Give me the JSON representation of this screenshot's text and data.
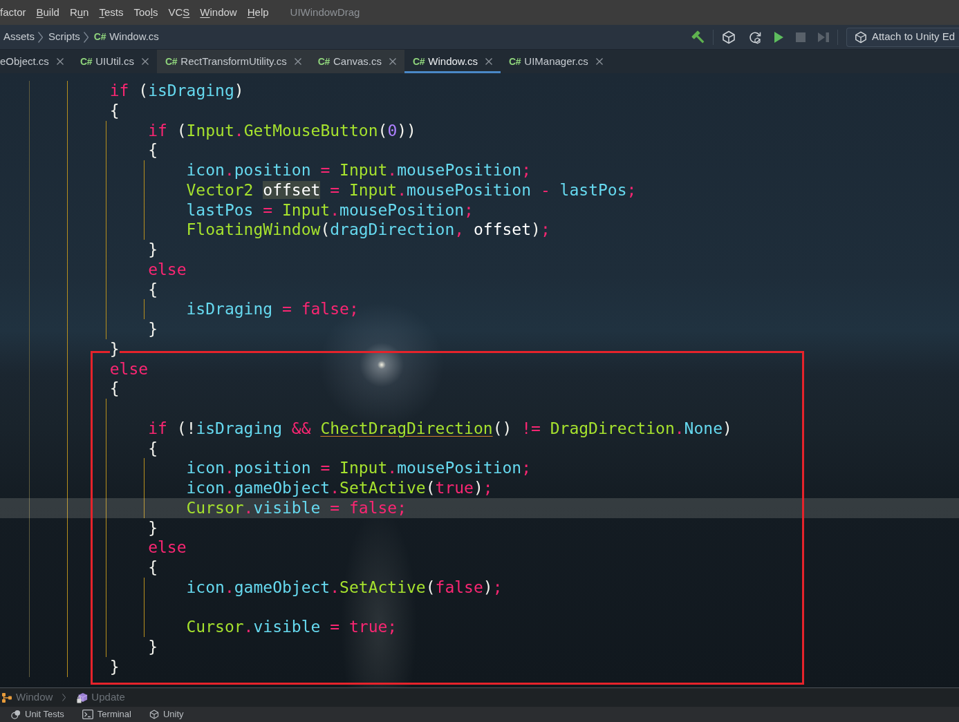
{
  "menu_bar": {
    "items": [
      {
        "label_parts": [
          {
            "kind": "plain",
            "text": "factor"
          }
        ]
      },
      {
        "label_parts": [
          {
            "kind": "mnemonic",
            "text": "B"
          },
          {
            "kind": "plain",
            "text": "uild"
          }
        ]
      },
      {
        "label_parts": [
          {
            "kind": "plain",
            "text": "R"
          },
          {
            "kind": "mnemonic",
            "text": "u"
          },
          {
            "kind": "plain",
            "text": "n"
          }
        ]
      },
      {
        "label_parts": [
          {
            "kind": "mnemonic",
            "text": "T"
          },
          {
            "kind": "plain",
            "text": "ests"
          }
        ]
      },
      {
        "label_parts": [
          {
            "kind": "plain",
            "text": "Too"
          },
          {
            "kind": "mnemonic",
            "text": "l"
          },
          {
            "kind": "plain",
            "text": "s"
          }
        ]
      },
      {
        "label_parts": [
          {
            "kind": "plain",
            "text": "VC"
          },
          {
            "kind": "mnemonic",
            "text": "S"
          }
        ]
      },
      {
        "label_parts": [
          {
            "kind": "mnemonic",
            "text": "W"
          },
          {
            "kind": "plain",
            "text": "indow"
          }
        ]
      },
      {
        "label_parts": [
          {
            "kind": "mnemonic",
            "text": "H"
          },
          {
            "kind": "plain",
            "text": "elp"
          }
        ]
      }
    ],
    "project_title": "UIWindowDrag"
  },
  "navigation_bar": {
    "breadcrumbs": [
      {
        "label": "Assets"
      },
      {
        "label": "Scripts"
      },
      {
        "file_icon": "C#",
        "label": "Window.cs"
      }
    ],
    "toolbar_groups": [
      {
        "buttons": [
          {
            "kind": "build",
            "disabled": false
          }
        ]
      },
      {
        "buttons": [
          {
            "kind": "unity",
            "disabled": false
          },
          {
            "kind": "refresh",
            "disabled": false
          },
          {
            "kind": "run",
            "disabled": false
          },
          {
            "kind": "stop",
            "disabled": true
          },
          {
            "kind": "step",
            "disabled": true
          }
        ]
      }
    ],
    "attach_button": {
      "label": "Attach to Unity Ed"
    }
  },
  "tabs": [
    {
      "label": "eObject.cs",
      "selected": false,
      "highlighted": false
    },
    {
      "file_icon": "C#",
      "label": "UIUtil.cs",
      "selected": false,
      "highlighted": false
    },
    {
      "file_icon": "C#",
      "label": "RectTransformUtility.cs",
      "selected": false,
      "highlighted": true
    },
    {
      "file_icon": "C#",
      "label": "Canvas.cs",
      "selected": false,
      "highlighted": true
    },
    {
      "file_icon": "C#",
      "label": "Window.cs",
      "selected": true,
      "highlighted": false
    },
    {
      "file_icon": "C#",
      "label": "UIManager.cs",
      "selected": false,
      "highlighted": false
    }
  ],
  "editor": {
    "annotation_box": true,
    "lines": [
      {
        "kind": "block",
        "children": [
          {
            "kind": "block",
            "children": [
              {
                "kind": "line",
                "current": false,
                "tokens": [
                  {
                    "kind": "keyword",
                    "text": "if"
                  },
                  {
                    "kind": "punct",
                    "text": " ("
                  },
                  {
                    "kind": "field",
                    "text": "isDraging"
                  },
                  {
                    "kind": "punct",
                    "text": ")"
                  }
                ]
              },
              {
                "kind": "line",
                "current": false,
                "tokens": [
                  {
                    "kind": "punct",
                    "text": "{"
                  }
                ]
              },
              {
                "kind": "block",
                "children": [
                  {
                    "kind": "line",
                    "current": false,
                    "tokens": [
                      {
                        "kind": "keyword",
                        "text": "if"
                      },
                      {
                        "kind": "punct",
                        "text": " ("
                      },
                      {
                        "kind": "type",
                        "text": "Input"
                      },
                      {
                        "kind": "operator",
                        "text": "."
                      },
                      {
                        "kind": "method",
                        "text": "GetMouseButton"
                      },
                      {
                        "kind": "punct",
                        "text": "("
                      },
                      {
                        "kind": "number",
                        "text": "0"
                      },
                      {
                        "kind": "punct",
                        "text": "))"
                      }
                    ]
                  },
                  {
                    "kind": "line",
                    "current": false,
                    "tokens": [
                      {
                        "kind": "punct",
                        "text": "{"
                      }
                    ]
                  },
                  {
                    "kind": "block",
                    "children": [
                      {
                        "kind": "line",
                        "current": false,
                        "tokens": [
                          {
                            "kind": "field",
                            "text": "icon"
                          },
                          {
                            "kind": "operator",
                            "text": "."
                          },
                          {
                            "kind": "field",
                            "text": "position"
                          },
                          {
                            "kind": "operator",
                            "text": " = "
                          },
                          {
                            "kind": "type",
                            "text": "Input"
                          },
                          {
                            "kind": "operator",
                            "text": "."
                          },
                          {
                            "kind": "field",
                            "text": "mousePosition"
                          },
                          {
                            "kind": "operator",
                            "text": ";"
                          }
                        ]
                      },
                      {
                        "kind": "line",
                        "current": false,
                        "tokens": [
                          {
                            "kind": "type",
                            "text": "Vector2 "
                          },
                          {
                            "kind": "localmarked",
                            "text": "offset"
                          },
                          {
                            "kind": "operator",
                            "text": " = "
                          },
                          {
                            "kind": "type",
                            "text": "Input"
                          },
                          {
                            "kind": "operator",
                            "text": "."
                          },
                          {
                            "kind": "field",
                            "text": "mousePosition"
                          },
                          {
                            "kind": "operator",
                            "text": " - "
                          },
                          {
                            "kind": "field",
                            "text": "lastPos"
                          },
                          {
                            "kind": "operator",
                            "text": ";"
                          }
                        ]
                      },
                      {
                        "kind": "line",
                        "current": false,
                        "tokens": [
                          {
                            "kind": "field",
                            "text": "lastPos"
                          },
                          {
                            "kind": "operator",
                            "text": " = "
                          },
                          {
                            "kind": "type",
                            "text": "Input"
                          },
                          {
                            "kind": "operator",
                            "text": "."
                          },
                          {
                            "kind": "field",
                            "text": "mousePosition"
                          },
                          {
                            "kind": "operator",
                            "text": ";"
                          }
                        ]
                      },
                      {
                        "kind": "line",
                        "current": false,
                        "tokens": [
                          {
                            "kind": "method",
                            "text": "FloatingWindow"
                          },
                          {
                            "kind": "punct",
                            "text": "("
                          },
                          {
                            "kind": "field",
                            "text": "dragDirection"
                          },
                          {
                            "kind": "operator",
                            "text": ", "
                          },
                          {
                            "kind": "local",
                            "text": "offset"
                          },
                          {
                            "kind": "punct",
                            "text": ")"
                          },
                          {
                            "kind": "operator",
                            "text": ";"
                          }
                        ]
                      }
                    ]
                  },
                  {
                    "kind": "line",
                    "current": false,
                    "tokens": [
                      {
                        "kind": "punct",
                        "text": "}"
                      }
                    ]
                  },
                  {
                    "kind": "line",
                    "current": false,
                    "tokens": [
                      {
                        "kind": "keyword",
                        "text": "else"
                      }
                    ]
                  },
                  {
                    "kind": "line",
                    "current": false,
                    "tokens": [
                      {
                        "kind": "punct",
                        "text": "{"
                      }
                    ]
                  },
                  {
                    "kind": "block",
                    "children": [
                      {
                        "kind": "line",
                        "current": false,
                        "tokens": [
                          {
                            "kind": "field",
                            "text": "isDraging"
                          },
                          {
                            "kind": "operator",
                            "text": " = "
                          },
                          {
                            "kind": "keyword",
                            "text": "false"
                          },
                          {
                            "kind": "operator",
                            "text": ";"
                          }
                        ]
                      }
                    ]
                  },
                  {
                    "kind": "line",
                    "current": false,
                    "tokens": [
                      {
                        "kind": "punct",
                        "text": "}"
                      }
                    ]
                  }
                ]
              },
              {
                "kind": "line",
                "current": false,
                "tokens": [
                  {
                    "kind": "punct",
                    "text": "}"
                  }
                ]
              },
              {
                "kind": "line",
                "current": false,
                "tokens": [
                  {
                    "kind": "keyword",
                    "text": "else"
                  }
                ]
              },
              {
                "kind": "line",
                "current": false,
                "tokens": [
                  {
                    "kind": "punct",
                    "text": "{"
                  }
                ]
              },
              {
                "kind": "block",
                "children": [
                  {
                    "kind": "blank"
                  },
                  {
                    "kind": "line",
                    "current": false,
                    "tokens": [
                      {
                        "kind": "keyword",
                        "text": "if"
                      },
                      {
                        "kind": "punct",
                        "text": " (!"
                      },
                      {
                        "kind": "field",
                        "text": "isDraging"
                      },
                      {
                        "kind": "operator",
                        "text": " && "
                      },
                      {
                        "kind": "flagged",
                        "text": "ChectDragDirection"
                      },
                      {
                        "kind": "punct",
                        "text": "()"
                      },
                      {
                        "kind": "operator",
                        "text": " != "
                      },
                      {
                        "kind": "type",
                        "text": "DragDirection"
                      },
                      {
                        "kind": "operator",
                        "text": "."
                      },
                      {
                        "kind": "field",
                        "text": "None"
                      },
                      {
                        "kind": "punct",
                        "text": ")"
                      }
                    ]
                  },
                  {
                    "kind": "line",
                    "current": false,
                    "tokens": [
                      {
                        "kind": "punct",
                        "text": "{"
                      }
                    ]
                  },
                  {
                    "kind": "block",
                    "children": [
                      {
                        "kind": "line",
                        "current": false,
                        "tokens": [
                          {
                            "kind": "field",
                            "text": "icon"
                          },
                          {
                            "kind": "operator",
                            "text": "."
                          },
                          {
                            "kind": "field",
                            "text": "position"
                          },
                          {
                            "kind": "operator",
                            "text": " = "
                          },
                          {
                            "kind": "type",
                            "text": "Input"
                          },
                          {
                            "kind": "operator",
                            "text": "."
                          },
                          {
                            "kind": "field",
                            "text": "mousePosition"
                          },
                          {
                            "kind": "operator",
                            "text": ";"
                          }
                        ]
                      },
                      {
                        "kind": "line",
                        "current": false,
                        "tokens": [
                          {
                            "kind": "field",
                            "text": "icon"
                          },
                          {
                            "kind": "operator",
                            "text": "."
                          },
                          {
                            "kind": "field",
                            "text": "gameObject"
                          },
                          {
                            "kind": "operator",
                            "text": "."
                          },
                          {
                            "kind": "method",
                            "text": "SetActive"
                          },
                          {
                            "kind": "punct",
                            "text": "("
                          },
                          {
                            "kind": "keyword",
                            "text": "true"
                          },
                          {
                            "kind": "punct",
                            "text": ")"
                          },
                          {
                            "kind": "operator",
                            "text": ";"
                          }
                        ]
                      },
                      {
                        "kind": "line",
                        "current": true,
                        "tokens": [
                          {
                            "kind": "type",
                            "text": "Cursor"
                          },
                          {
                            "kind": "operator",
                            "text": "."
                          },
                          {
                            "kind": "field",
                            "text": "visible"
                          },
                          {
                            "kind": "operator",
                            "text": " = "
                          },
                          {
                            "kind": "keyword",
                            "text": "false"
                          },
                          {
                            "kind": "operator",
                            "text": ";"
                          }
                        ]
                      }
                    ]
                  },
                  {
                    "kind": "line",
                    "current": false,
                    "tokens": [
                      {
                        "kind": "punct",
                        "text": "}"
                      }
                    ]
                  },
                  {
                    "kind": "line",
                    "current": false,
                    "tokens": [
                      {
                        "kind": "keyword",
                        "text": "else"
                      }
                    ]
                  },
                  {
                    "kind": "line",
                    "current": false,
                    "tokens": [
                      {
                        "kind": "punct",
                        "text": "{"
                      }
                    ]
                  },
                  {
                    "kind": "block",
                    "children": [
                      {
                        "kind": "line",
                        "current": false,
                        "tokens": [
                          {
                            "kind": "field",
                            "text": "icon"
                          },
                          {
                            "kind": "operator",
                            "text": "."
                          },
                          {
                            "kind": "field",
                            "text": "gameObject"
                          },
                          {
                            "kind": "operator",
                            "text": "."
                          },
                          {
                            "kind": "method",
                            "text": "SetActive"
                          },
                          {
                            "kind": "punct",
                            "text": "("
                          },
                          {
                            "kind": "keyword",
                            "text": "false"
                          },
                          {
                            "kind": "punct",
                            "text": ")"
                          },
                          {
                            "kind": "operator",
                            "text": ";"
                          }
                        ]
                      },
                      {
                        "kind": "blank"
                      },
                      {
                        "kind": "line",
                        "current": false,
                        "tokens": [
                          {
                            "kind": "type",
                            "text": "Cursor"
                          },
                          {
                            "kind": "operator",
                            "text": "."
                          },
                          {
                            "kind": "field",
                            "text": "visible"
                          },
                          {
                            "kind": "operator",
                            "text": " = "
                          },
                          {
                            "kind": "keyword",
                            "text": "true"
                          },
                          {
                            "kind": "operator",
                            "text": ";"
                          }
                        ]
                      }
                    ]
                  },
                  {
                    "kind": "line",
                    "current": false,
                    "tokens": [
                      {
                        "kind": "punct",
                        "text": "}"
                      }
                    ]
                  }
                ]
              },
              {
                "kind": "line",
                "current": false,
                "tokens": [
                  {
                    "kind": "punct",
                    "text": "}"
                  }
                ]
              }
            ]
          }
        ]
      }
    ]
  },
  "status_breadcrumb": [
    {
      "kind": "class",
      "label": "Window"
    },
    {
      "kind": "method",
      "label": "Update"
    }
  ],
  "tool_windows": [
    {
      "kind": "tests",
      "label": "Unit Tests"
    },
    {
      "kind": "terminal",
      "label": "Terminal"
    },
    {
      "kind": "unity",
      "label": "Unity"
    }
  ]
}
